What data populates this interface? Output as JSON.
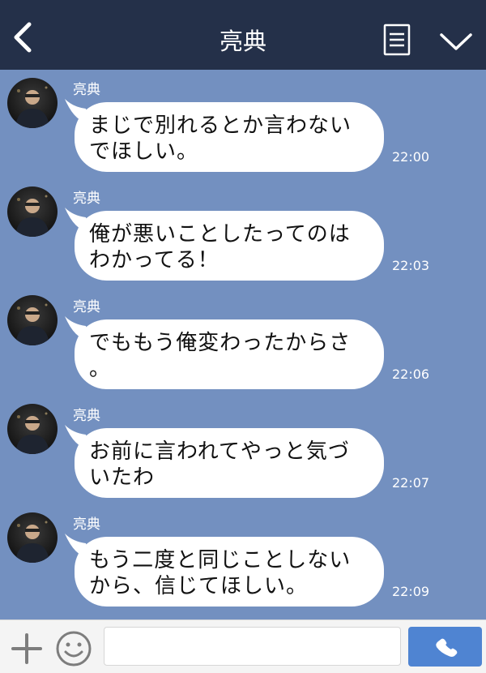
{
  "header": {
    "title": "亮典"
  },
  "messages": [
    {
      "sender": "亮典",
      "lines": [
        "まじで別れるとか言わない",
        "でほしい。"
      ],
      "time": "22:00"
    },
    {
      "sender": "亮典",
      "lines": [
        "俺が悪いことしたってのは",
        "わかってる！"
      ],
      "time": "22:03"
    },
    {
      "sender": "亮典",
      "lines": [
        "でももう俺変わったからさ",
        "。"
      ],
      "time": "22:06"
    },
    {
      "sender": "亮典",
      "lines": [
        "お前に言われてやっと気づ",
        "いたわ"
      ],
      "time": "22:07"
    },
    {
      "sender": "亮典",
      "lines": [
        "もう二度と同じことしない",
        "から、信じてほしい。"
      ],
      "time": "22:09"
    }
  ],
  "input": {
    "placeholder": ""
  },
  "colors": {
    "header": "#243049",
    "chat_background": "#7390c0",
    "call_button": "#4f84d2"
  },
  "icons": [
    "back-icon",
    "menu-icon",
    "chevron-down-icon",
    "plus-icon",
    "emoji-icon",
    "phone-icon"
  ]
}
